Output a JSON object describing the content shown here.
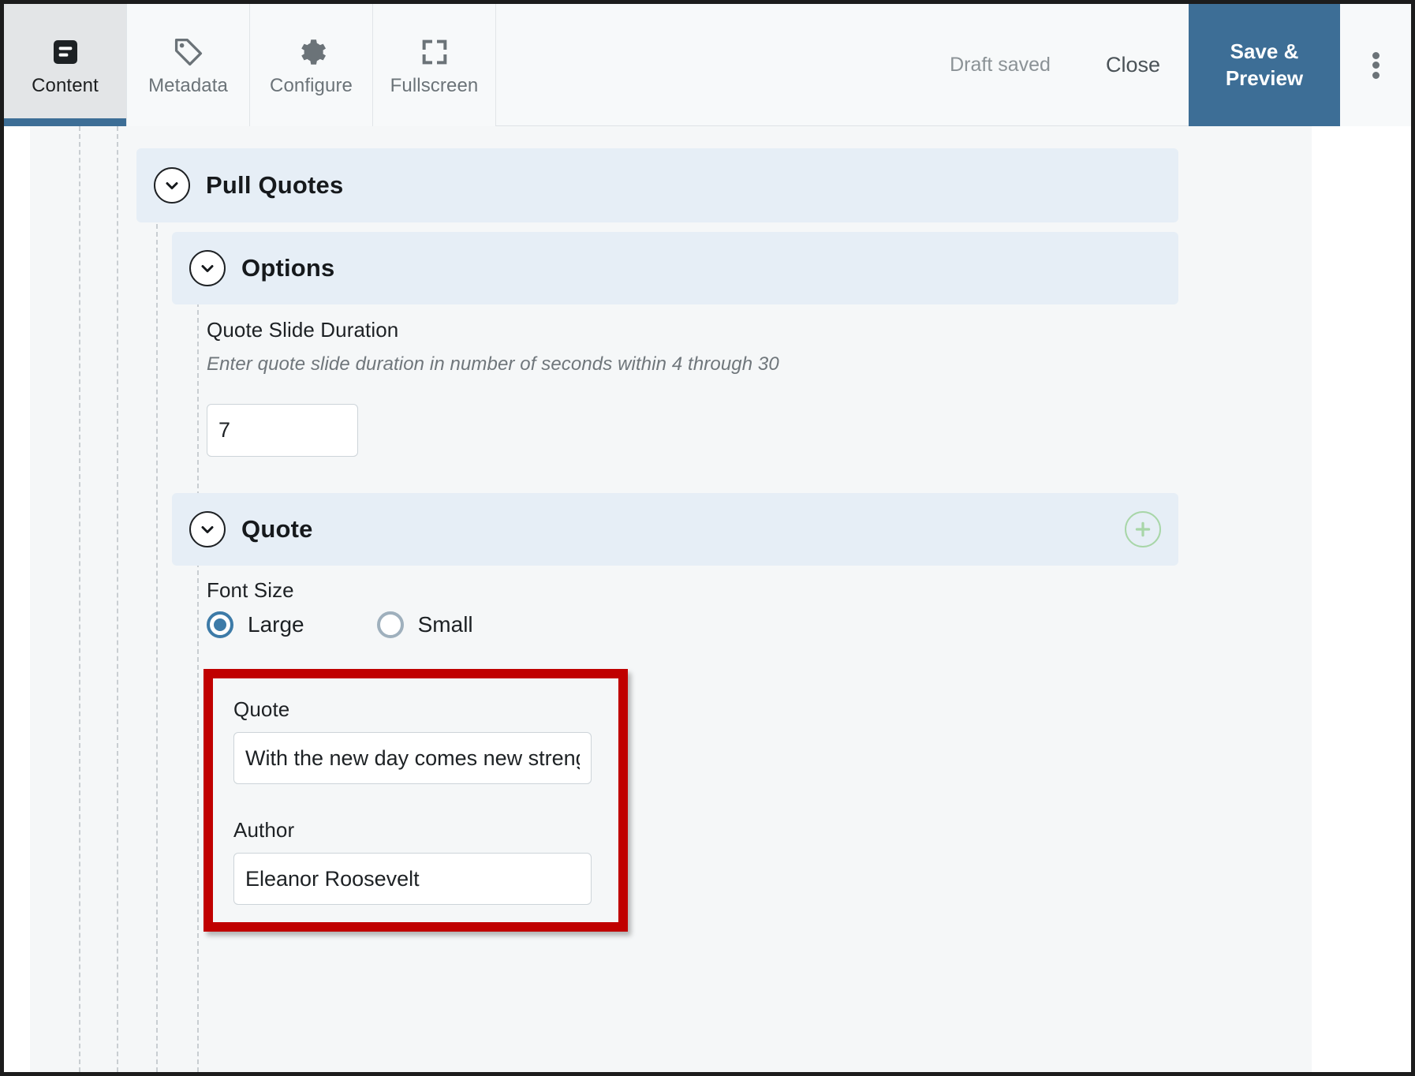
{
  "toolbar": {
    "tabs": [
      {
        "label": "Content",
        "icon": "document-lines-icon",
        "active": true
      },
      {
        "label": "Metadata",
        "icon": "tag-icon",
        "active": false
      },
      {
        "label": "Configure",
        "icon": "gear-icon",
        "active": false
      },
      {
        "label": "Fullscreen",
        "icon": "expand-icon",
        "active": false
      }
    ],
    "status_text": "Draft saved",
    "close_label": "Close",
    "primary_label": "Save & Preview",
    "overflow_icon": "kebab-menu-icon",
    "accent_color": "#3d6e96"
  },
  "content": {
    "pull_quotes": {
      "title": "Pull Quotes",
      "chevron_icon": "chevron-down-icon"
    },
    "options": {
      "title": "Options",
      "chevron_icon": "chevron-down-icon",
      "duration": {
        "label": "Quote Slide Duration",
        "help": "Enter quote slide duration in number of seconds within 4 through 30",
        "value": "7"
      }
    },
    "quote_section": {
      "title": "Quote",
      "chevron_icon": "chevron-down-icon",
      "add_icon": "plus-circle-icon",
      "add_color": "#a8d6a8",
      "font_size": {
        "label": "Font Size",
        "selected": "Large",
        "options": [
          {
            "label": "Large",
            "selected": true
          },
          {
            "label": "Small",
            "selected": false
          }
        ]
      },
      "quote_field": {
        "label": "Quote",
        "value": "With the new day comes new strength"
      },
      "author_field": {
        "label": "Author",
        "value": "Eleanor Roosevelt"
      },
      "highlight_color": "#c00000"
    }
  }
}
